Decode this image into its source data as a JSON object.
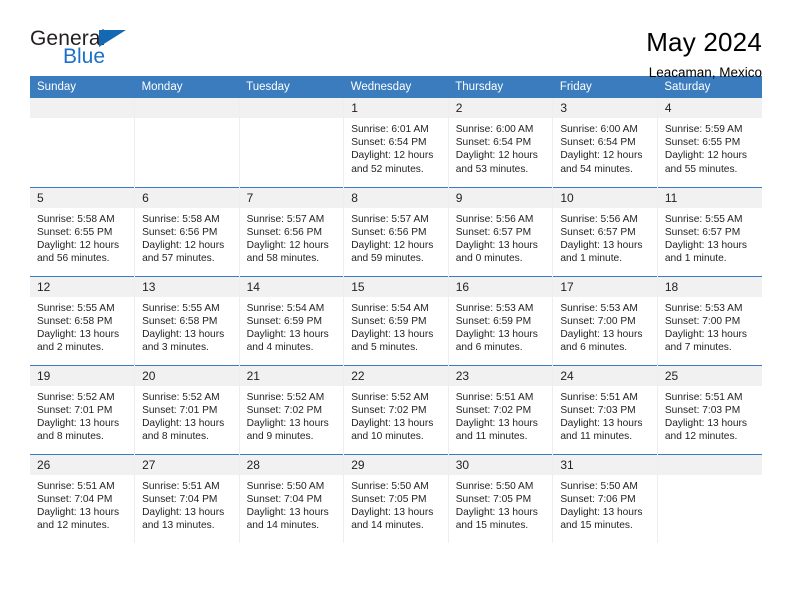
{
  "brand": {
    "name_part1": "General",
    "name_part2": "Blue",
    "accent_color": "#1569b4"
  },
  "header": {
    "title": "May 2024",
    "subtitle": "Leacaman, Mexico"
  },
  "calendar": {
    "header_bg": "#3a7cbe",
    "daynum_bg": "#f1f1f1",
    "weekday_headers": [
      "Sunday",
      "Monday",
      "Tuesday",
      "Wednesday",
      "Thursday",
      "Friday",
      "Saturday"
    ],
    "weeks": [
      [
        {
          "day": "",
          "empty": true
        },
        {
          "day": "",
          "empty": true
        },
        {
          "day": "",
          "empty": true
        },
        {
          "day": "1",
          "sunrise": "Sunrise: 6:01 AM",
          "sunset": "Sunset: 6:54 PM",
          "daylight": "Daylight: 12 hours and 52 minutes."
        },
        {
          "day": "2",
          "sunrise": "Sunrise: 6:00 AM",
          "sunset": "Sunset: 6:54 PM",
          "daylight": "Daylight: 12 hours and 53 minutes."
        },
        {
          "day": "3",
          "sunrise": "Sunrise: 6:00 AM",
          "sunset": "Sunset: 6:54 PM",
          "daylight": "Daylight: 12 hours and 54 minutes."
        },
        {
          "day": "4",
          "sunrise": "Sunrise: 5:59 AM",
          "sunset": "Sunset: 6:55 PM",
          "daylight": "Daylight: 12 hours and 55 minutes."
        }
      ],
      [
        {
          "day": "5",
          "sunrise": "Sunrise: 5:58 AM",
          "sunset": "Sunset: 6:55 PM",
          "daylight": "Daylight: 12 hours and 56 minutes."
        },
        {
          "day": "6",
          "sunrise": "Sunrise: 5:58 AM",
          "sunset": "Sunset: 6:56 PM",
          "daylight": "Daylight: 12 hours and 57 minutes."
        },
        {
          "day": "7",
          "sunrise": "Sunrise: 5:57 AM",
          "sunset": "Sunset: 6:56 PM",
          "daylight": "Daylight: 12 hours and 58 minutes."
        },
        {
          "day": "8",
          "sunrise": "Sunrise: 5:57 AM",
          "sunset": "Sunset: 6:56 PM",
          "daylight": "Daylight: 12 hours and 59 minutes."
        },
        {
          "day": "9",
          "sunrise": "Sunrise: 5:56 AM",
          "sunset": "Sunset: 6:57 PM",
          "daylight": "Daylight: 13 hours and 0 minutes."
        },
        {
          "day": "10",
          "sunrise": "Sunrise: 5:56 AM",
          "sunset": "Sunset: 6:57 PM",
          "daylight": "Daylight: 13 hours and 1 minute."
        },
        {
          "day": "11",
          "sunrise": "Sunrise: 5:55 AM",
          "sunset": "Sunset: 6:57 PM",
          "daylight": "Daylight: 13 hours and 1 minute."
        }
      ],
      [
        {
          "day": "12",
          "sunrise": "Sunrise: 5:55 AM",
          "sunset": "Sunset: 6:58 PM",
          "daylight": "Daylight: 13 hours and 2 minutes."
        },
        {
          "day": "13",
          "sunrise": "Sunrise: 5:55 AM",
          "sunset": "Sunset: 6:58 PM",
          "daylight": "Daylight: 13 hours and 3 minutes."
        },
        {
          "day": "14",
          "sunrise": "Sunrise: 5:54 AM",
          "sunset": "Sunset: 6:59 PM",
          "daylight": "Daylight: 13 hours and 4 minutes."
        },
        {
          "day": "15",
          "sunrise": "Sunrise: 5:54 AM",
          "sunset": "Sunset: 6:59 PM",
          "daylight": "Daylight: 13 hours and 5 minutes."
        },
        {
          "day": "16",
          "sunrise": "Sunrise: 5:53 AM",
          "sunset": "Sunset: 6:59 PM",
          "daylight": "Daylight: 13 hours and 6 minutes."
        },
        {
          "day": "17",
          "sunrise": "Sunrise: 5:53 AM",
          "sunset": "Sunset: 7:00 PM",
          "daylight": "Daylight: 13 hours and 6 minutes."
        },
        {
          "day": "18",
          "sunrise": "Sunrise: 5:53 AM",
          "sunset": "Sunset: 7:00 PM",
          "daylight": "Daylight: 13 hours and 7 minutes."
        }
      ],
      [
        {
          "day": "19",
          "sunrise": "Sunrise: 5:52 AM",
          "sunset": "Sunset: 7:01 PM",
          "daylight": "Daylight: 13 hours and 8 minutes."
        },
        {
          "day": "20",
          "sunrise": "Sunrise: 5:52 AM",
          "sunset": "Sunset: 7:01 PM",
          "daylight": "Daylight: 13 hours and 8 minutes."
        },
        {
          "day": "21",
          "sunrise": "Sunrise: 5:52 AM",
          "sunset": "Sunset: 7:02 PM",
          "daylight": "Daylight: 13 hours and 9 minutes."
        },
        {
          "day": "22",
          "sunrise": "Sunrise: 5:52 AM",
          "sunset": "Sunset: 7:02 PM",
          "daylight": "Daylight: 13 hours and 10 minutes."
        },
        {
          "day": "23",
          "sunrise": "Sunrise: 5:51 AM",
          "sunset": "Sunset: 7:02 PM",
          "daylight": "Daylight: 13 hours and 11 minutes."
        },
        {
          "day": "24",
          "sunrise": "Sunrise: 5:51 AM",
          "sunset": "Sunset: 7:03 PM",
          "daylight": "Daylight: 13 hours and 11 minutes."
        },
        {
          "day": "25",
          "sunrise": "Sunrise: 5:51 AM",
          "sunset": "Sunset: 7:03 PM",
          "daylight": "Daylight: 13 hours and 12 minutes."
        }
      ],
      [
        {
          "day": "26",
          "sunrise": "Sunrise: 5:51 AM",
          "sunset": "Sunset: 7:04 PM",
          "daylight": "Daylight: 13 hours and 12 minutes."
        },
        {
          "day": "27",
          "sunrise": "Sunrise: 5:51 AM",
          "sunset": "Sunset: 7:04 PM",
          "daylight": "Daylight: 13 hours and 13 minutes."
        },
        {
          "day": "28",
          "sunrise": "Sunrise: 5:50 AM",
          "sunset": "Sunset: 7:04 PM",
          "daylight": "Daylight: 13 hours and 14 minutes."
        },
        {
          "day": "29",
          "sunrise": "Sunrise: 5:50 AM",
          "sunset": "Sunset: 7:05 PM",
          "daylight": "Daylight: 13 hours and 14 minutes."
        },
        {
          "day": "30",
          "sunrise": "Sunrise: 5:50 AM",
          "sunset": "Sunset: 7:05 PM",
          "daylight": "Daylight: 13 hours and 15 minutes."
        },
        {
          "day": "31",
          "sunrise": "Sunrise: 5:50 AM",
          "sunset": "Sunset: 7:06 PM",
          "daylight": "Daylight: 13 hours and 15 minutes."
        },
        {
          "day": "",
          "empty": true
        }
      ]
    ]
  }
}
